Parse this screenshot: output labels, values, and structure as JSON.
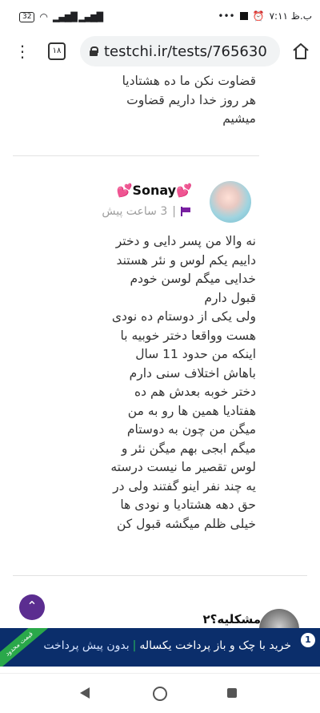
{
  "status_bar": {
    "battery": "32",
    "time": "۷:۱۱ ب.ظ",
    "dots": "•••"
  },
  "browser": {
    "tab_count": "۱۸",
    "url": "testchi.ir/tests/765630"
  },
  "comments": [
    {
      "lines": [
        "قضاوت نکن ما ده هشتادیا",
        "هر روز خدا داریم قضاوت",
        "میشیم"
      ]
    },
    {
      "author": "Sonay",
      "time": "3 ساعت پیش",
      "lines": [
        "نه والا من پسر دایی و دختر",
        "داییم یکم لوس و نئر هستند",
        "خدایی میگم لوسن خودم",
        "قبول دارم",
        "ولی یکی از دوستام ده نودی",
        "هست وواقعا دختر خوبیه با",
        "اینکه من حدود 11 سال",
        "باهاش اختلاف سنی دارم",
        "دختر خوبه بعدش هم ده",
        "هفتادیا همین ها رو به من",
        "میگن من چون به دوستام",
        "میگم ابجی بهم میگن نئر و",
        "لوس تقصیر ما نیست درسته",
        "یه چند نفر اینو گفتند ولی در",
        "حق دهه هشتادیا و نودی ها",
        "خیلی ظلم میگشه قبول کن"
      ]
    },
    {
      "title": "مشکلیه؟۲"
    }
  ],
  "ad": {
    "ribbon": "قیمت محدود",
    "main": "خرید با چک و باز پرداخت یکساله",
    "sub": "بدون پیش پرداخت",
    "badge": "1"
  },
  "icons": [
    "battery-icon",
    "wifi-icon",
    "signal-icon",
    "menu-dots-icon",
    "lock-icon",
    "home-icon",
    "flag-icon",
    "heart-icon",
    "chevron-up-icon",
    "back-icon",
    "home-nav-icon",
    "recents-icon"
  ],
  "colors": {
    "accent": "#5b2d90",
    "ad_bg": "#0b2e6b",
    "heart": "#e91e63"
  }
}
